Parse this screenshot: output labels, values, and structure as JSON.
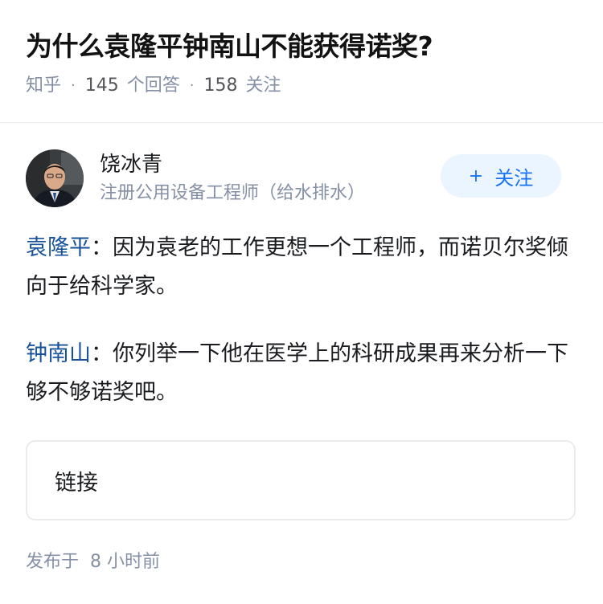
{
  "question": {
    "title": "为什么袁隆平钟南山不能获得诺奖?",
    "source": "知乎",
    "answer_count": "145",
    "answer_label": "个回答",
    "follower_count": "158",
    "follower_label": "关注",
    "separator": "·"
  },
  "author": {
    "name": "饶冰青",
    "headline": "注册公用设备工程师（给水排水）",
    "follow_icon": "+",
    "follow_label": "关注"
  },
  "answer": {
    "paragraphs": [
      {
        "mention": "袁隆平",
        "text": "：因为袁老的工作更想一个工程师，而诺贝尔奖倾向于给科学家。"
      },
      {
        "mention": "钟南山",
        "text": "：你列举一下他在医学上的科研成果再来分析一下够不够诺奖吧。"
      }
    ],
    "link_label": "链接",
    "published_label": "发布于",
    "published_time": "8 小时前"
  },
  "colors": {
    "mention": "#175199",
    "meta": "#8590a6",
    "follow_bg": "#ebf5ff",
    "follow_text": "#1772f6"
  }
}
